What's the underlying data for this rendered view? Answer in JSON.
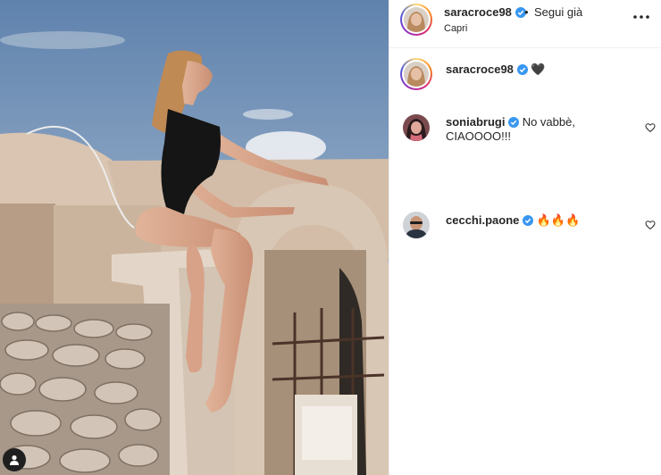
{
  "post": {
    "author": "saracroce98",
    "follow_status": "Segui già",
    "location": "Capri",
    "caption": "🖤",
    "photo_description_icon": "user-tag-icon"
  },
  "comments": [
    {
      "author": "soniabrugi",
      "verified": true,
      "text": "No vabbè, CIAOOOO!!!"
    },
    {
      "author": "cecchi.paone",
      "verified": true,
      "text": "🔥🔥🔥"
    }
  ],
  "colors": {
    "verified": "#3897f0",
    "text": "#262626",
    "border": "#efefef"
  },
  "icons": {
    "header_more": "more-options-icon",
    "like": "heart-outline-icon",
    "verified": "verified-badge-icon"
  }
}
